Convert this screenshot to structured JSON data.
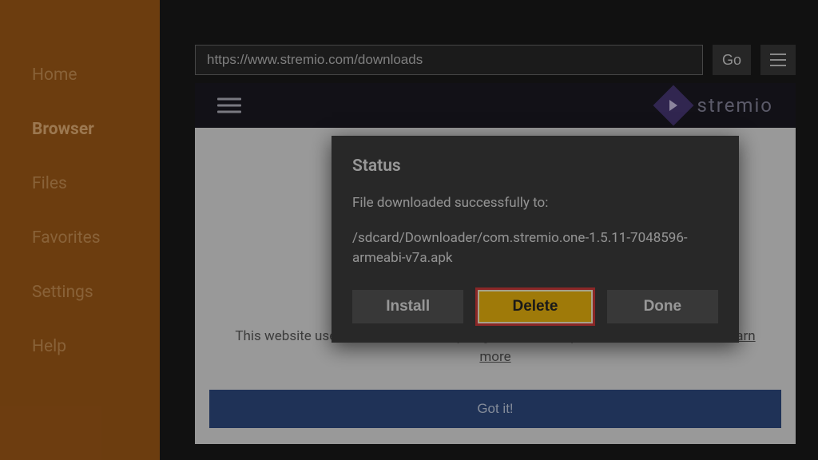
{
  "sidebar": {
    "items": [
      {
        "label": "Home"
      },
      {
        "label": "Browser"
      },
      {
        "label": "Files"
      },
      {
        "label": "Favorites"
      },
      {
        "label": "Settings"
      },
      {
        "label": "Help"
      }
    ],
    "active_index": 1
  },
  "topbar": {
    "url": "https://www.stremio.com/downloads",
    "go_label": "Go"
  },
  "site": {
    "brand": "stremio",
    "cookie_text": "This website uses cookies to ensure you get the best experience on our website.",
    "learn_more": "Learn more",
    "gotit_label": "Got it!"
  },
  "modal": {
    "title": "Status",
    "message": "File downloaded successfully to:",
    "path": "/sdcard/Downloader/com.stremio.one-1.5.11-7048596-armeabi-v7a.apk",
    "install_label": "Install",
    "delete_label": "Delete",
    "done_label": "Done"
  }
}
